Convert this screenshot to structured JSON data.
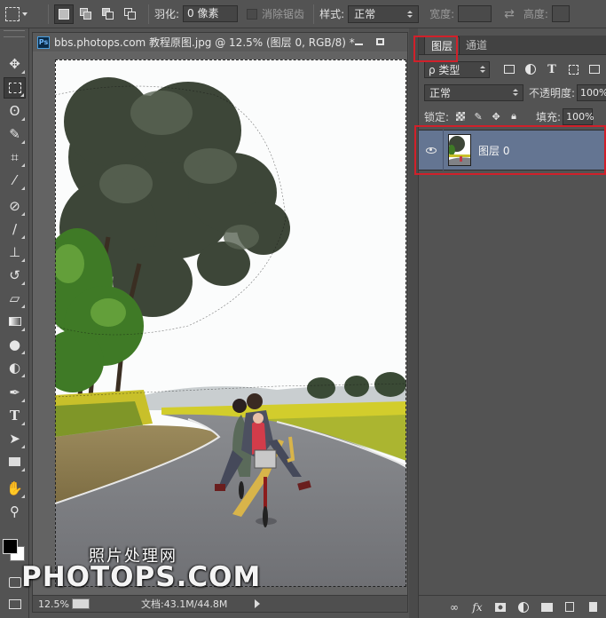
{
  "options_bar": {
    "feather_label": "羽化:",
    "feather_value": "0 像素",
    "antialias_label": "消除锯齿",
    "style_label": "样式:",
    "style_value": "正常",
    "width_label": "宽度:",
    "height_label": "高度:"
  },
  "document": {
    "title": "bbs.photops.com 教程原图.jpg @ 12.5% (图层 0, RGB/8) *",
    "watermark_cn": "照片处理网",
    "watermark_en": "PHOTOPS.COM"
  },
  "status_bar": {
    "zoom": "12.5%",
    "doc_info": "文档:43.1M/44.8M"
  },
  "layers_panel": {
    "tab_layers": "图层",
    "tab_channels": "通道",
    "kind_filter": "ρ 类型",
    "blend_mode": "正常",
    "opacity_label": "不透明度:",
    "opacity_value": "100%",
    "lock_label": "锁定:",
    "fill_label": "填充:",
    "fill_value": "100%",
    "layers": [
      {
        "name": "图层 0",
        "visible": true,
        "selected": true
      }
    ]
  },
  "colors": {
    "foreground": "#000000",
    "background": "#ffffff",
    "selected_layer": "#647592",
    "annotation_red": "#d1202a"
  }
}
